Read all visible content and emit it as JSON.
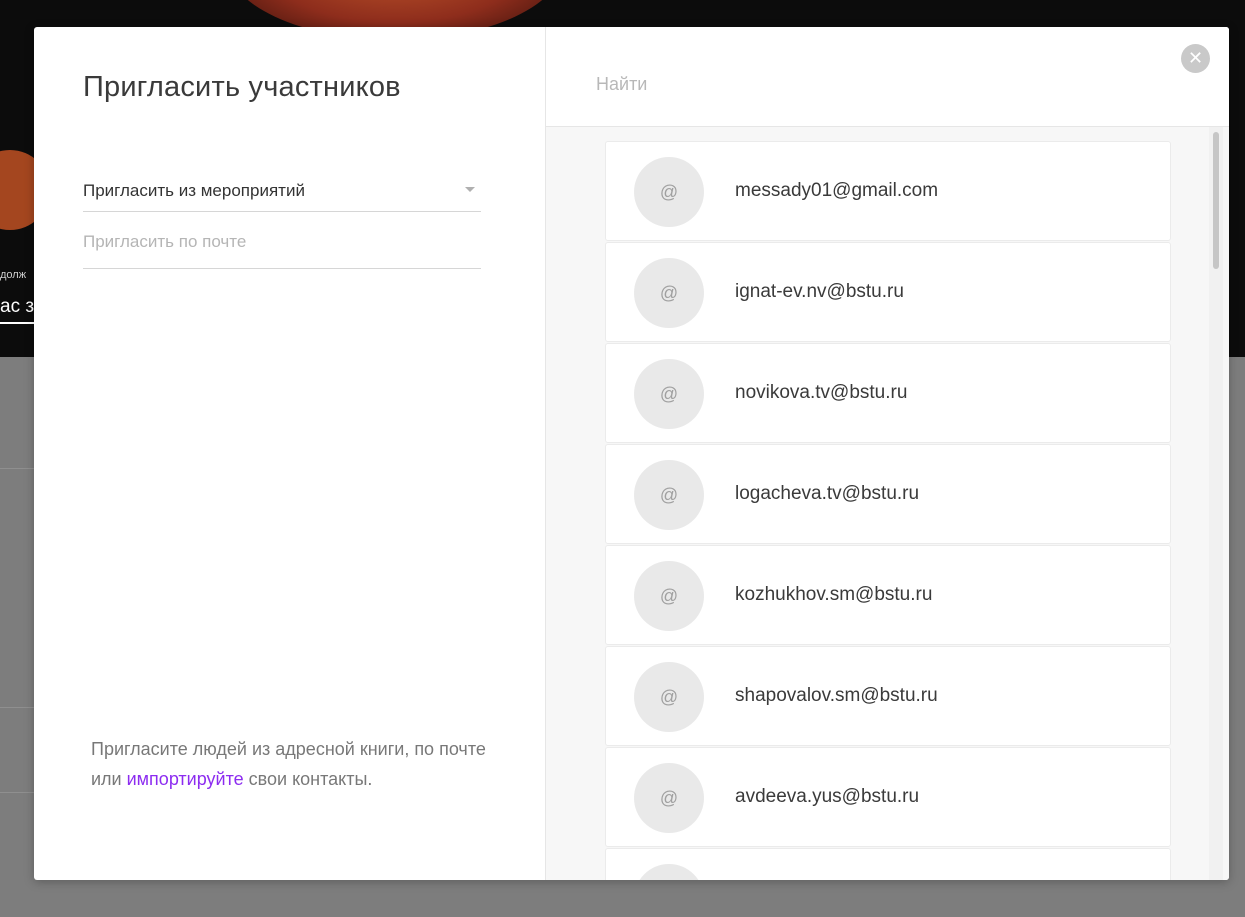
{
  "background": {
    "hero_small_text": "долж",
    "hero_big_text": "ас з"
  },
  "modal": {
    "title": "Пригласить участников",
    "invite_from_events": {
      "value": "Пригласить из мероприятий",
      "icon": "chevron-down-icon"
    },
    "invite_by_email": {
      "placeholder": "Пригласить по почте",
      "value": ""
    },
    "hint": {
      "before": "Пригласите людей из адресной книги, по почте или ",
      "link": "импортируйте",
      "after": " свои контакты.",
      "link_color": "#8c2cf0"
    },
    "search": {
      "placeholder": "Найти",
      "value": ""
    },
    "close": {
      "icon": "close-icon",
      "glyph": "✕"
    }
  },
  "contacts": [
    {
      "avatar": "@",
      "email": "messady01@gmail.com"
    },
    {
      "avatar": "@",
      "email": "ignat-ev.nv@bstu.ru"
    },
    {
      "avatar": "@",
      "email": "novikova.tv@bstu.ru"
    },
    {
      "avatar": "@",
      "email": "logacheva.tv@bstu.ru"
    },
    {
      "avatar": "@",
      "email": "kozhukhov.sm@bstu.ru"
    },
    {
      "avatar": "@",
      "email": "shapovalov.sm@bstu.ru"
    },
    {
      "avatar": "@",
      "email": "avdeeva.yus@bstu.ru"
    },
    {
      "avatar": "@",
      "email": ""
    }
  ]
}
